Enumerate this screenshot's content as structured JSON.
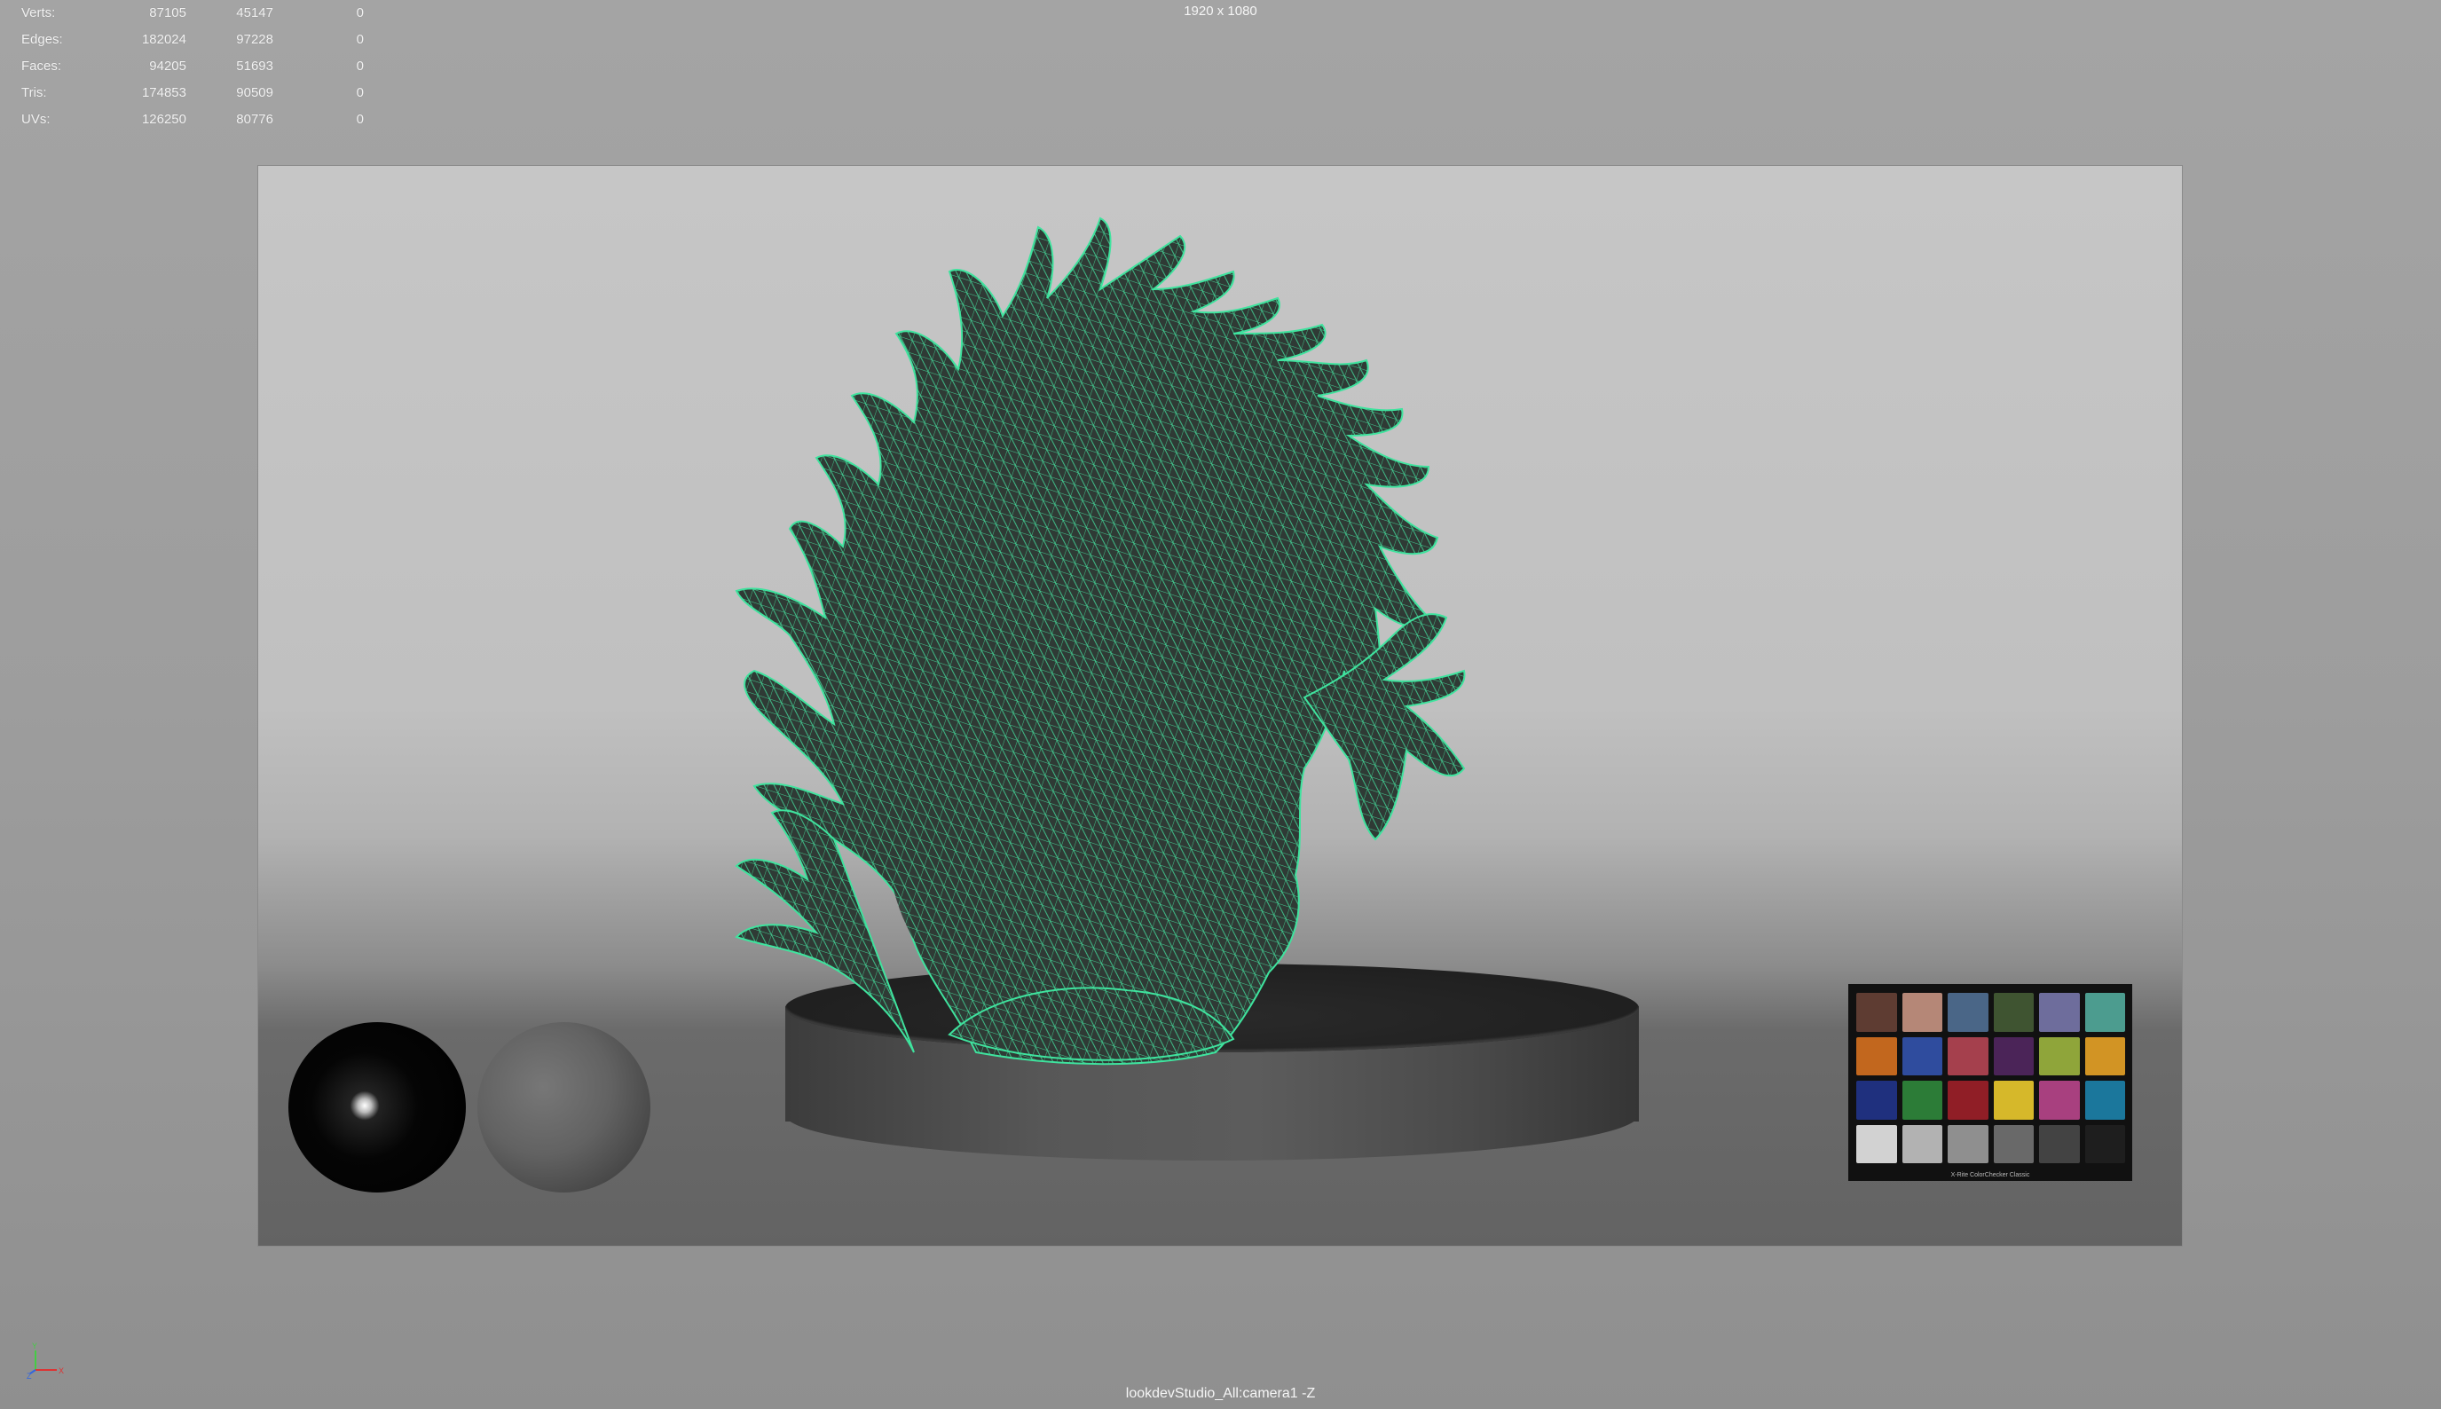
{
  "hud": {
    "rows": [
      {
        "label": "Verts:",
        "c1": "87105",
        "c2": "45147",
        "c3": "0"
      },
      {
        "label": "Edges:",
        "c1": "182024",
        "c2": "97228",
        "c3": "0"
      },
      {
        "label": "Faces:",
        "c1": "94205",
        "c2": "51693",
        "c3": "0"
      },
      {
        "label": "Tris:",
        "c1": "174853",
        "c2": "90509",
        "c3": "0"
      },
      {
        "label": "UVs:",
        "c1": "126250",
        "c2": "80776",
        "c3": "0"
      }
    ]
  },
  "viewport": {
    "resolution": "1920 x 1080",
    "camera": "lookdevStudio_All:camera1 -Z"
  },
  "color_checker": {
    "caption": "X-Rite ColorChecker Classic",
    "swatches": [
      "#5e3c32",
      "#b58777",
      "#4a6687",
      "#3f5431",
      "#6e6d9c",
      "#4c9c8f",
      "#c2671e",
      "#2f4c9e",
      "#a5404d",
      "#4b2458",
      "#8fa53a",
      "#d29424",
      "#1f307e",
      "#2c7c37",
      "#901e26",
      "#d6b82a",
      "#a8407f",
      "#1b779c",
      "#d2d2d2",
      "#b2b2b2",
      "#8f8f8f",
      "#696969",
      "#434343",
      "#1e1e1e"
    ]
  },
  "colors": {
    "wireframe": "#3fe39e",
    "coral_fill": "#2e4a3f"
  },
  "axis": {
    "y": "Y",
    "z": "Z",
    "x": "X"
  }
}
